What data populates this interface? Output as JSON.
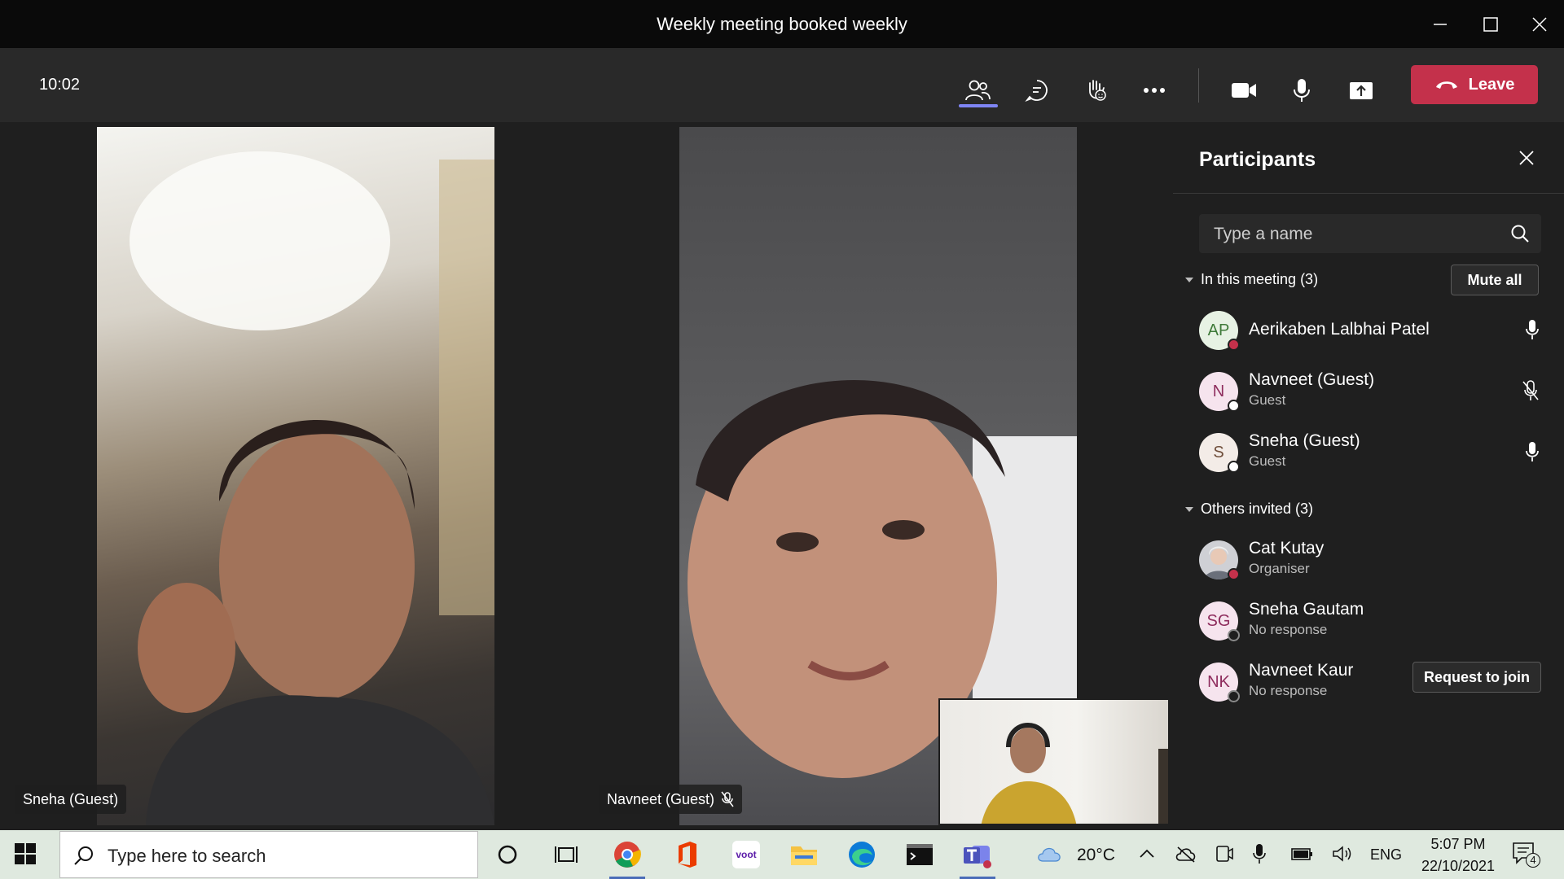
{
  "window": {
    "title": "Weekly meeting booked weekly"
  },
  "toolbar": {
    "clock": "10:02",
    "leave_label": "Leave",
    "icons": [
      "people-icon",
      "chat-icon",
      "raise-hand-icon",
      "more-icon",
      "camera-icon",
      "mic-icon",
      "share-icon"
    ]
  },
  "videos": [
    {
      "name": "Sneha (Guest)",
      "muted": false
    },
    {
      "name": "Navneet (Guest)",
      "muted": true
    }
  ],
  "panel": {
    "title": "Participants",
    "search_placeholder": "Type a name",
    "in_meeting_label": "In this meeting (3)",
    "mute_all_label": "Mute all",
    "in_meeting": [
      {
        "initials": "AP",
        "name": "Aerikaben Lalbhai Patel",
        "sub": "",
        "status": "busy",
        "avatar_color": "#e7f2e4",
        "initials_color": "#3f7a3a",
        "mic": "on"
      },
      {
        "initials": "N",
        "name": "Navneet (Guest)",
        "sub": "Guest",
        "status": "guest",
        "avatar_color": "#f6e4ee",
        "initials_color": "#8e2c5d",
        "mic": "off"
      },
      {
        "initials": "S",
        "name": "Sneha (Guest)",
        "sub": "Guest",
        "status": "guest",
        "avatar_color": "#f3ece7",
        "initials_color": "#6f4e3a",
        "mic": "on"
      }
    ],
    "others_label": "Others invited (3)",
    "others": [
      {
        "initials": "",
        "name": "Cat Kutay",
        "sub": "Organiser",
        "status": "busy",
        "avatar_color": "#cfd0d5",
        "initials_color": "#333333",
        "photo": true
      },
      {
        "initials": "SG",
        "name": "Sneha Gautam",
        "sub": "No response",
        "status": "none",
        "avatar_color": "#f6e4ee",
        "initials_color": "#8e2c5d"
      },
      {
        "initials": "NK",
        "name": "Navneet Kaur",
        "sub": "No response",
        "status": "none",
        "avatar_color": "#f6e4ee",
        "initials_color": "#8e2c5d",
        "action": "Request to join"
      }
    ]
  },
  "taskbar": {
    "search_placeholder": "Type here to search",
    "weather": "20°C",
    "lang": "ENG",
    "time": "5:07 PM",
    "date": "22/10/2021",
    "notification_count": "4"
  },
  "colors": {
    "leave": "#c4314b",
    "accent": "#7f85f5",
    "busy": "#c4314b"
  }
}
